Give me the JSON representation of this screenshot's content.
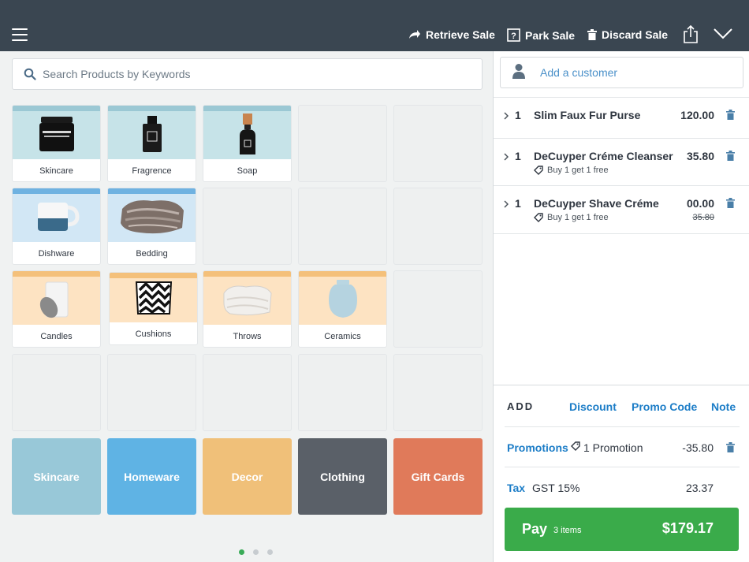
{
  "header": {
    "retrieve_label": "Retrieve Sale",
    "park_label": "Park Sale",
    "discard_label": "Discard Sale"
  },
  "search": {
    "placeholder": "Search Products by Keywords"
  },
  "products": [
    {
      "label": "Skincare",
      "theme": "teal",
      "icon": "skincare-jar-icon"
    },
    {
      "label": "Fragrence",
      "theme": "teal",
      "icon": "fragrance-bottle-icon"
    },
    {
      "label": "Soap",
      "theme": "teal",
      "icon": "soap-bottle-icon"
    },
    {
      "label": "Dishware",
      "theme": "blue",
      "icon": "mug-icon"
    },
    {
      "label": "Bedding",
      "theme": "blue",
      "icon": "blanket-icon"
    },
    {
      "label": "Candles",
      "theme": "orange",
      "icon": "candle-icon"
    },
    {
      "label": "Cushions",
      "theme": "orange",
      "icon": "cushion-icon"
    },
    {
      "label": "Throws",
      "theme": "orange",
      "icon": "throw-icon"
    },
    {
      "label": "Ceramics",
      "theme": "orange",
      "icon": "vase-icon"
    }
  ],
  "categories": [
    {
      "label": "Skincare",
      "color": "#98c8d8"
    },
    {
      "label": "Homeware",
      "color": "#5fb3e4"
    },
    {
      "label": "Decor",
      "color": "#f0c079"
    },
    {
      "label": "Clothing",
      "color": "#5a6068"
    },
    {
      "label": "Gift Cards",
      "color": "#e07a5a"
    }
  ],
  "pagination": {
    "pages": 3,
    "current": 1
  },
  "customer": {
    "placeholder": "Add a customer"
  },
  "cart": [
    {
      "qty": "1",
      "name": "Slim Faux Fur Purse",
      "price": "120.00"
    },
    {
      "qty": "1",
      "name": "DeCuyper Créme Cleanser",
      "price": "35.80",
      "promo": "Buy 1 get 1 free"
    },
    {
      "qty": "1",
      "name": "DeCuyper Shave Créme",
      "price": "00.00",
      "original_price": "35.80",
      "promo": "Buy 1 get 1 free"
    }
  ],
  "summary": {
    "add_label": "ADD",
    "discount_label": "Discount",
    "promo_code_label": "Promo Code",
    "note_label": "Note",
    "promotions_label": "Promotions",
    "promotions_count": "1 Promotion",
    "promotions_amount": "-35.80",
    "tax_label": "Tax",
    "tax_desc": "GST 15%",
    "tax_amount": "23.37"
  },
  "pay": {
    "label": "Pay",
    "items": "3 items",
    "total": "$179.17"
  },
  "colors": {
    "header": "#3a4651",
    "accent": "#1c7dc7",
    "pay": "#3aab4a"
  }
}
